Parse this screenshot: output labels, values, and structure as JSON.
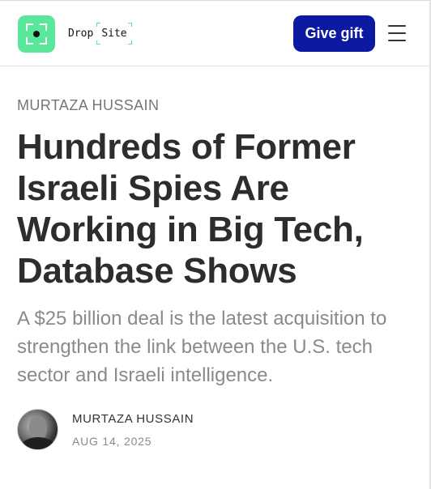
{
  "header": {
    "logo_icon": "drop-site-logo-icon",
    "brand": {
      "word1": "Drop",
      "word2": "Site"
    },
    "gift_button_label": "Give gift",
    "menu_icon": "hamburger-menu-icon",
    "colors": {
      "logo_bg": "#58e79b",
      "gift_button_bg": "#0b1aa0"
    }
  },
  "article": {
    "top_byline": "MURTAZA HUSSAIN",
    "headline": "Hundreds of Former Israeli Spies Are Working in Big Tech, Database Shows",
    "dek": "A $25 billion deal is the latest acquisition to strengthen the link between the U.S. tech sector and Israeli intelligence.",
    "author": {
      "avatar_icon": "author-avatar",
      "name": "MURTAZA HUSSAIN",
      "date": "AUG 14, 2025"
    }
  }
}
